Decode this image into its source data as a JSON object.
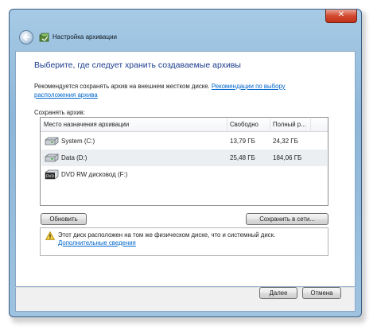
{
  "window": {
    "title": "Настройка архивации",
    "close_glyph": "✕",
    "accent": "#1a3b8c"
  },
  "main": {
    "heading": "Выберите, где следует хранить создаваемые архивы",
    "recommend_text": "Рекомендуется сохранять архив на внешнем жестком диске.",
    "recommend_link": "Рекомендации по выбору расположения архива",
    "save_label": "Сохранять архив:"
  },
  "table": {
    "columns": [
      "Место назначения архивации",
      "Свободно",
      "Полный р..."
    ],
    "rows": [
      {
        "name": "System (C:)",
        "free": "13,79 ГБ",
        "total": "24,32 ГБ",
        "icon": "hard-drive-icon",
        "selected": false
      },
      {
        "name": "Data (D:)",
        "free": "25,48 ГБ",
        "total": "184,06 ГБ",
        "icon": "hard-drive-icon",
        "selected": true
      },
      {
        "name": "DVD RW дисковод (F:)",
        "free": "",
        "total": "",
        "icon": "dvd-drive-icon",
        "selected": false
      }
    ]
  },
  "buttons": {
    "refresh": "Обновить",
    "save_network": "Сохранить в сети...",
    "next": "Далее",
    "cancel": "Отмена"
  },
  "warning": {
    "icon": "warning-icon",
    "text": "Этот диск расположен на том же физическом диске, что и системный диск.",
    "link": "Дополнительные сведения"
  }
}
